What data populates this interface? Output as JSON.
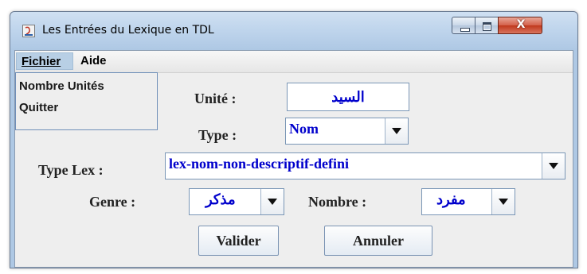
{
  "window": {
    "title": "Les Entrées du Lexique en TDL",
    "close_glyph": "X"
  },
  "menubar": {
    "fichier": "Fichier",
    "aide": "Aide",
    "popup_items": [
      "Nombre Unités",
      "Quitter"
    ]
  },
  "form": {
    "unite_label": "Unité :",
    "unite_value": "السيد",
    "type_label": "Type :",
    "type_value": "Nom",
    "typelex_label": "Type Lex :",
    "typelex_value": "lex-nom-non-descriptif-defini",
    "genre_label": "Genre :",
    "genre_value": "مذكر",
    "nombre_label": "Nombre :",
    "nombre_value": "مفرد"
  },
  "buttons": {
    "valider": "Valider",
    "annuler": "Annuler"
  },
  "colors": {
    "value_text": "#0000cc",
    "menu_highlight": "#b8cfe5",
    "titlebar": "#bad1ea",
    "close_button": "#c0381c"
  },
  "icons": [
    "app-icon",
    "minimize-icon",
    "maximize-icon",
    "close-icon",
    "chevron-down-icon"
  ]
}
